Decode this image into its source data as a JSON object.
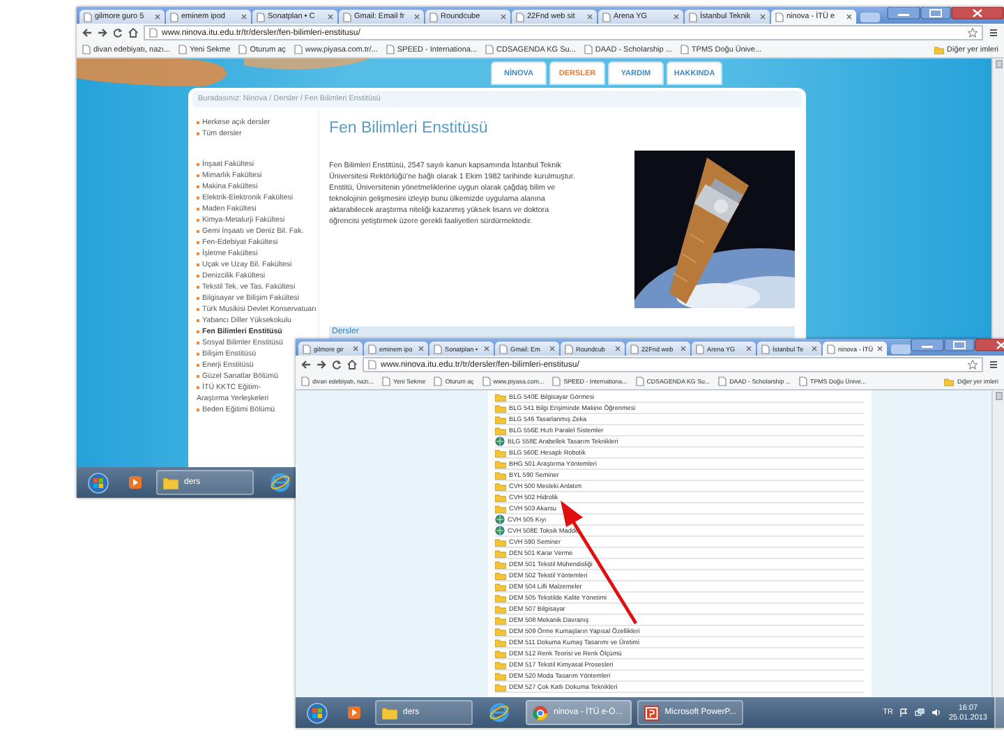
{
  "back_window": {
    "tabs": [
      {
        "label": "gilmore guro 5",
        "selected": false
      },
      {
        "label": "eminem ipod",
        "selected": false
      },
      {
        "label": "Sonatplan • C",
        "selected": false
      },
      {
        "label": "Gmail: Email fr",
        "selected": false
      },
      {
        "label": "Roundcube",
        "selected": false
      },
      {
        "label": "22Fnd web sit",
        "selected": false
      },
      {
        "label": "Arena YG",
        "selected": false
      },
      {
        "label": "İstanbul Teknik",
        "selected": false
      },
      {
        "label": "ninova - İTÜ e",
        "selected": true
      }
    ],
    "address": "www.ninova.itu.edu.tr/tr/dersler/fen-bilimleri-enstitusu/",
    "bookmarks": [
      "divan edebiyatı, nazı...",
      "Yeni Sekme",
      "Oturum aç",
      "www.piyasa.com.tr/...",
      "SPEED - Internationa...",
      "CDSAGENDA KG Su...",
      "DAAD - Scholarship ...",
      "TPMS Doğu Ünive..."
    ],
    "other_bookmarks": "Diğer yer imleri",
    "page": {
      "nav": [
        {
          "label": "NİNOVA",
          "selected": false
        },
        {
          "label": "DERSLER",
          "selected": true
        },
        {
          "label": "YARDIM",
          "selected": false
        },
        {
          "label": "HAKKINDA",
          "selected": false
        }
      ],
      "breadcrumb": "Buradasınız: Ninova / Dersler / Fen Bilimleri Enstitüsü",
      "top_links": [
        "Herkese açık dersler",
        "Tüm dersler"
      ],
      "faculties": [
        {
          "label": "İnşaat Fakültesi",
          "selected": false
        },
        {
          "label": "Mimarlık Fakültesi",
          "selected": false
        },
        {
          "label": "Makina Fakültesi",
          "selected": false
        },
        {
          "label": "Elektrik-Elektronik Fakültesi",
          "selected": false
        },
        {
          "label": "Maden Fakültesi",
          "selected": false
        },
        {
          "label": "Kimya-Metalurji Fakültesi",
          "selected": false
        },
        {
          "label": "Gemi İnşaatı ve Deniz Bil. Fak.",
          "selected": false
        },
        {
          "label": "Fen-Edebiyat Fakültesi",
          "selected": false
        },
        {
          "label": "İşletme Fakültesi",
          "selected": false
        },
        {
          "label": "Uçak ve Uzay Bil. Fakültesi",
          "selected": false
        },
        {
          "label": "Denizcilik Fakültesi",
          "selected": false
        },
        {
          "label": "Tekstil Tek. ve Tas. Fakültesi",
          "selected": false
        },
        {
          "label": "Bilgisayar ve Bilişim Fakültesi",
          "selected": false
        },
        {
          "label": "Türk Musikisi Devlet Konservatuarı",
          "selected": false
        },
        {
          "label": "Yabancı Diller Yüksekokulu",
          "selected": false
        },
        {
          "label": "Fen Bilimleri Enstitüsü",
          "selected": true
        },
        {
          "label": "Sosyal Bilimler Enstitüsü",
          "selected": false
        },
        {
          "label": "Bilişim Enstitüsü",
          "selected": false
        },
        {
          "label": "Enerji Enstitüsü",
          "selected": false
        },
        {
          "label": "Güzel Sanatlar Bölümü",
          "selected": false
        },
        {
          "label": "İTÜ KKTC Eğitim-Araştırma Yerleşkeleri",
          "selected": false
        },
        {
          "label": "Beden Eğitimi Bölümü",
          "selected": false
        }
      ],
      "title": "Fen Bilimleri Enstitüsü",
      "paragraph": "Fen Bilimleri Enstitüsü, 2547 sayılı kanun kapsamında İstanbul Teknik Üniversitesi Rektörlüğü'ne bağlı olarak 1 Ekim 1982 tarihinde kurulmuştur. Enstitü, Üniversitenin yönetmeliklerine uygun olarak çağdaş bilim ve teknolojinin gelişmesini izleyip bunu ülkemizde uygulama alanına aktarabilecek araştırma niteliği kazanmış yüksek lisans ve doktora öğrencisi yetiştirmek üzere gerekli faaliyetleri sürdürmektedir.",
      "section_heading": "Dersler"
    },
    "taskbar": {
      "items": [
        {
          "kind": "start"
        },
        {
          "kind": "media"
        },
        {
          "kind": "folder",
          "label": "ders"
        },
        {
          "kind": "ie"
        }
      ]
    }
  },
  "front_window": {
    "tabs": [
      {
        "label": "gilmore gir",
        "selected": false
      },
      {
        "label": "eminem ipo",
        "selected": false
      },
      {
        "label": "Sonatplan •",
        "selected": false
      },
      {
        "label": "Gmail: Em",
        "selected": false
      },
      {
        "label": "Roundcub",
        "selected": false
      },
      {
        "label": "22Fnd web",
        "selected": false
      },
      {
        "label": "Arena YG",
        "selected": false
      },
      {
        "label": "İstanbul Te",
        "selected": false
      },
      {
        "label": "ninova - İTÜ",
        "selected": true
      }
    ],
    "address": "www.ninova.itu.edu.tr/tr/dersler/fen-bilimleri-enstitusu/",
    "bookmarks": [
      "divan edebiyatı, nazı...",
      "Yeni Sekme",
      "Oturum aç",
      "www.piyasa.com...",
      "SPEED - Internationa...",
      "CDSAGENDA KG Su...",
      "DAAD - Scholarship ...",
      "TPMS Doğu Ünive..."
    ],
    "other_bookmarks": "Diğer yer imleri",
    "page": {
      "courses": [
        {
          "label": "BLG 540E Bilgisayar Görmesi",
          "kind": "folder"
        },
        {
          "label": "BLG 541 Bilgi Erişiminde Makine Öğrenmesi",
          "kind": "folder"
        },
        {
          "label": "BLG 546 Tasarlanmış Zeka",
          "kind": "folder"
        },
        {
          "label": "BLG 556E Hızlı Paralel Sistemler",
          "kind": "folder"
        },
        {
          "label": "BLG 558E Arabellek Tasarım Teknikleri",
          "kind": "shared"
        },
        {
          "label": "BLG 560E Hesaplı Robotik",
          "kind": "folder"
        },
        {
          "label": "BHG 501 Araştırma Yöntemleri",
          "kind": "folder"
        },
        {
          "label": "BYL 590 Seminer",
          "kind": "folder"
        },
        {
          "label": "CVH 500 Mesleki Anlatım",
          "kind": "folder"
        },
        {
          "label": "CVH 502 Hidrolik",
          "kind": "folder"
        },
        {
          "label": "CVH 503 Akarsu",
          "kind": "folder"
        },
        {
          "label": "CVH 505 Kıyı",
          "kind": "shared"
        },
        {
          "label": "CVH 508E Toksik Madde",
          "kind": "shared"
        },
        {
          "label": "CVH 590 Seminer",
          "kind": "folder"
        },
        {
          "label": "DEN 501 Karar Verme",
          "kind": "folder"
        },
        {
          "label": "DEM 501 Tekstil Mühendisliği",
          "kind": "folder"
        },
        {
          "label": "DEM 502 Tekstil Yöntemleri",
          "kind": "folder"
        },
        {
          "label": "DEM 504 Lifli Malzemeler",
          "kind": "folder"
        },
        {
          "label": "DEM 505 Tekstilde Kalite Yönetimi",
          "kind": "folder"
        },
        {
          "label": "DEM 507 Bilgisayar",
          "kind": "folder"
        },
        {
          "label": "DEM 508 Mekanik Davranış",
          "kind": "folder"
        },
        {
          "label": "DEM 509 Örme Kumaşların Yapısal Özellikleri",
          "kind": "folder"
        },
        {
          "label": "DEM 511 Dokuma Kumaş Tasarımı ve Üretimi",
          "kind": "folder"
        },
        {
          "label": "DEM 512 Renk Teorisi ve Renk Ölçümü",
          "kind": "folder"
        },
        {
          "label": "DEM 517 Tekstil Kimyasal Prosesleri",
          "kind": "folder"
        },
        {
          "label": "DEM 520 Moda Tasarım Yöntemleri",
          "kind": "folder"
        },
        {
          "label": "DEM 527 Çok Katlı Dokuma Teknikleri",
          "kind": "folder"
        }
      ]
    },
    "taskbar": {
      "items": [
        {
          "kind": "start"
        },
        {
          "kind": "media"
        },
        {
          "kind": "folder",
          "label": "ders"
        },
        {
          "kind": "ie"
        },
        {
          "kind": "chrome",
          "label": "ninova - İTÜ e-Ö..."
        },
        {
          "kind": "powerpoint",
          "label": "Microsoft PowerP..."
        }
      ],
      "language": "TR",
      "time": "16:07",
      "date": "25.01.2013"
    }
  }
}
